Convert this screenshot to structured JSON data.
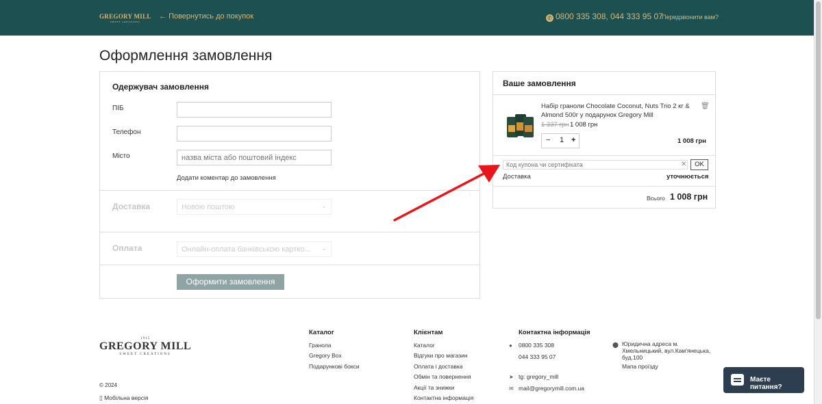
{
  "header": {
    "logo_name": "GREGORY MILL",
    "logo_sub": "SWEET CREATIONS",
    "back_link": "Повернутись до покупок",
    "phones": "0800 335 308,  044 333 95 07",
    "callback": "Передзвонити вам?",
    "bg_color": "#1d5050",
    "accent_color": "#d7b777"
  },
  "page_title": "Оформлення замовлення",
  "recipient": {
    "title": "Одержувач замовлення",
    "name_label": "ПІБ",
    "phone_label": "Телефон",
    "city_label": "Місто",
    "city_placeholder": "назва міста або поштовий індекс",
    "comment_link": "Додати коментар до замовлення"
  },
  "delivery": {
    "title": "Доставка",
    "selected": "Новою поштою"
  },
  "payment": {
    "title": "Оплата",
    "selected": "Онлайн-оплата банківською картко..."
  },
  "submit_label": "Оформити замовлення",
  "order": {
    "title": "Ваше замовлення",
    "product_name": "Набір граноли Chocolate Coconut, Nuts Trio 2 кг & Almond 500г у подарунок Gregory Mill",
    "old_price": "1 337 грн",
    "new_price": "1 008 грн",
    "qty_minus": "−",
    "qty": "1",
    "qty_plus": "+",
    "line_total": "1 008 грн",
    "coupon_placeholder": "Код купона чи сертифіката",
    "coupon_ok": "OK",
    "delivery_label": "Доставка",
    "delivery_value": "уточнюється",
    "total_label": "Всього",
    "total_value": "1 008 грн"
  },
  "footer": {
    "logo_year": "1915",
    "logo_name": "GREGORY MILL",
    "logo_sub": "SWEET CREATIONS",
    "copyright": "© 2024",
    "mobile": "Мобільна версія",
    "catalog": {
      "title": "Каталог",
      "items": [
        "Гранола",
        "Gregory Box",
        "Подарункові бокси"
      ]
    },
    "clients": {
      "title": "Клієнтам",
      "items": [
        "Каталог",
        "Відгуки про магазин",
        "Оплата і доставка",
        "Обмін та повернення",
        "Акції та знижки",
        "Контактна інформація"
      ]
    },
    "contacts": {
      "title": "Контактна інформація",
      "phone1": "0800 335 308",
      "phone2": "044 333 95 07",
      "telegram": "tg: gregory_mill",
      "email": "mail@gregorymill.com.ua",
      "address": "Юридична адреса м. Хмельницький, вул.Кам'янецька, буд.100",
      "map": "Мапа проїзду"
    }
  },
  "chat_label": "Маєте питання?"
}
